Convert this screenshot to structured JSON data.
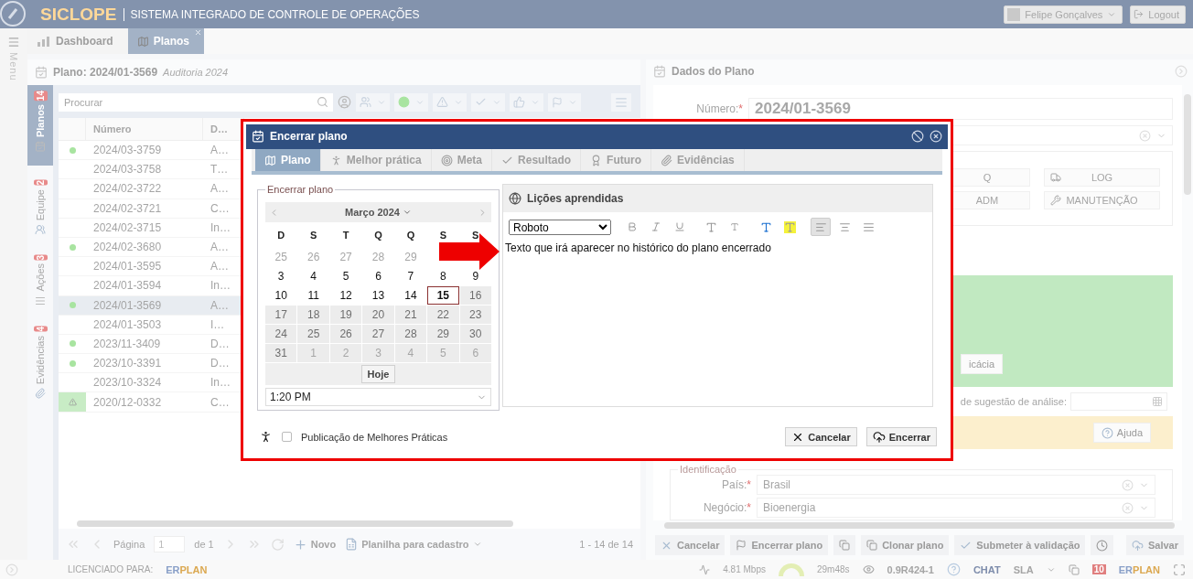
{
  "header": {
    "logo": "SICLOPE",
    "subtitle": "SISTEMA INTEGRADO DE CONTROLE DE OPERAÇÕES",
    "user": "Felipe Gonçalves",
    "logout": "Logout"
  },
  "side_menu": {
    "label": "Menu"
  },
  "tabs": [
    {
      "label": "Dashboard",
      "selected": false
    },
    {
      "label": "Planos",
      "selected": true
    }
  ],
  "plan_panel": {
    "title": "Plano: 2024/01-3569",
    "subtitle": "Auditoria 2024",
    "side_tabs": [
      {
        "label": "Planos",
        "count": "14",
        "selected": true
      },
      {
        "label": "Equipe",
        "count": "2",
        "selected": false
      },
      {
        "label": "Ações",
        "count": "3",
        "selected": false
      },
      {
        "label": "Evidências",
        "count": "4",
        "selected": false
      }
    ],
    "search": {
      "placeholder": "Procurar"
    },
    "table": {
      "columns": [
        "Número",
        "D…"
      ],
      "rows": [
        {
          "kind": "ok",
          "number": "2024/03-3759",
          "column_2": "A…",
          "selected": false
        },
        {
          "kind": "none",
          "number": "2024/03-3758",
          "column_2": "T…",
          "selected": false
        },
        {
          "kind": "none",
          "number": "2024/02-3722",
          "column_2": "A…",
          "selected": false
        },
        {
          "kind": "none",
          "number": "2024/02-3721",
          "column_2": "C…",
          "selected": false
        },
        {
          "kind": "none",
          "number": "2024/02-3715",
          "column_2": "In…",
          "selected": false
        },
        {
          "kind": "ok",
          "number": "2024/02-3680",
          "column_2": "A…",
          "selected": false
        },
        {
          "kind": "none",
          "number": "2024/01-3595",
          "column_2": "A…",
          "selected": false
        },
        {
          "kind": "none",
          "number": "2024/01-3594",
          "column_2": "In…",
          "selected": false
        },
        {
          "kind": "ok",
          "number": "2024/01-3569",
          "column_2": "A…",
          "selected": true
        },
        {
          "kind": "none",
          "number": "2024/01-3503",
          "column_2": "I…",
          "selected": false
        },
        {
          "kind": "ok",
          "number": "2023/11-3409",
          "column_2": "D…",
          "selected": false
        },
        {
          "kind": "ok",
          "number": "2023/10-3391",
          "column_2": "D…",
          "selected": false
        },
        {
          "kind": "none",
          "number": "2023/10-3324",
          "column_2": "In…",
          "selected": false
        },
        {
          "kind": "warning",
          "number": "2020/12-0332",
          "column_2": "C…",
          "selected": false
        }
      ]
    },
    "pager": {
      "page_label": "Página",
      "page": "1",
      "of": "de 1",
      "new": "Novo",
      "sheet": "Planilha para cadastro",
      "range": "1 - 14 de 14"
    }
  },
  "data_panel": {
    "title": "Dados do Plano",
    "number_label": "Número:",
    "number_mark": "*",
    "number": "2024/01-3569",
    "modules": [
      "Q",
      "LOG",
      "ADM",
      "MANUTENÇÃO"
    ],
    "efficacy_button": "icácia",
    "date_label": "de sugestão de análise:",
    "help": "Ajuda",
    "identification": {
      "legend": "Identificação",
      "fields": [
        {
          "label": "País:",
          "mark": "*",
          "value": "Brasil"
        },
        {
          "label": "Negócio:",
          "mark": "*",
          "value": "Bioenergia"
        }
      ]
    },
    "actions": [
      "Cancelar",
      "Encerrar plano",
      "Clonar plano",
      "Submeter à validação",
      "Salvar"
    ]
  },
  "status_bar": {
    "licensed": "LICENCIADO PARA:",
    "brand": [
      "ER",
      "PLAN"
    ],
    "brand_right": [
      "ER",
      "PLAN"
    ],
    "speed": "4.81 Mbps",
    "timer": "29m48s",
    "version": "0.9R424-1",
    "chat": "CHAT",
    "sla": "SLA",
    "count": "10"
  },
  "dialog": {
    "title": "Encerrar plano",
    "tabs": [
      {
        "label": "Plano",
        "selected": true
      },
      {
        "label": "Melhor prática",
        "selected": false
      },
      {
        "label": "Meta",
        "selected": false
      },
      {
        "label": "Resultado",
        "selected": false
      },
      {
        "label": "Futuro",
        "selected": false
      },
      {
        "label": "Evidências",
        "selected": false
      }
    ],
    "legend": "Encerrar plano",
    "month": "Março 2024",
    "weekdays": [
      "D",
      "S",
      "T",
      "Q",
      "Q",
      "S",
      "S"
    ],
    "weeks": [
      [
        {
          "d": "25",
          "muted": true,
          "disabled": false,
          "selected": false
        },
        {
          "d": "26",
          "muted": true,
          "disabled": false,
          "selected": false
        },
        {
          "d": "27",
          "muted": true,
          "disabled": false,
          "selected": false
        },
        {
          "d": "28",
          "muted": true,
          "disabled": false,
          "selected": false
        },
        {
          "d": "29",
          "muted": true,
          "disabled": false,
          "selected": false
        }
      ],
      [
        {
          "d": "3",
          "muted": false,
          "disabled": false,
          "selected": false
        },
        {
          "d": "4",
          "muted": false,
          "disabled": false,
          "selected": false
        },
        {
          "d": "5",
          "muted": false,
          "disabled": false,
          "selected": false
        },
        {
          "d": "6",
          "muted": false,
          "disabled": false,
          "selected": false
        },
        {
          "d": "7",
          "muted": false,
          "disabled": false,
          "selected": false
        },
        {
          "d": "8",
          "muted": false,
          "disabled": false,
          "selected": false
        },
        {
          "d": "9",
          "muted": false,
          "disabled": false,
          "selected": false
        }
      ],
      [
        {
          "d": "10",
          "muted": false,
          "disabled": false,
          "selected": false
        },
        {
          "d": "11",
          "muted": false,
          "disabled": false,
          "selected": false
        },
        {
          "d": "12",
          "muted": false,
          "disabled": false,
          "selected": false
        },
        {
          "d": "13",
          "muted": false,
          "disabled": false,
          "selected": false
        },
        {
          "d": "14",
          "muted": false,
          "disabled": false,
          "selected": false
        },
        {
          "d": "15",
          "muted": false,
          "disabled": false,
          "selected": true
        },
        {
          "d": "16",
          "muted": false,
          "disabled": true,
          "selected": false
        }
      ],
      [
        {
          "d": "17",
          "muted": false,
          "disabled": true,
          "selected": false
        },
        {
          "d": "18",
          "muted": false,
          "disabled": true,
          "selected": false
        },
        {
          "d": "19",
          "muted": false,
          "disabled": true,
          "selected": false
        },
        {
          "d": "20",
          "muted": false,
          "disabled": true,
          "selected": false
        },
        {
          "d": "21",
          "muted": false,
          "disabled": true,
          "selected": false
        },
        {
          "d": "22",
          "muted": false,
          "disabled": true,
          "selected": false
        },
        {
          "d": "23",
          "muted": false,
          "disabled": true,
          "selected": false
        }
      ],
      [
        {
          "d": "24",
          "muted": false,
          "disabled": true,
          "selected": false
        },
        {
          "d": "25",
          "muted": false,
          "disabled": true,
          "selected": false
        },
        {
          "d": "26",
          "muted": false,
          "disabled": true,
          "selected": false
        },
        {
          "d": "27",
          "muted": false,
          "disabled": true,
          "selected": false
        },
        {
          "d": "28",
          "muted": false,
          "disabled": true,
          "selected": false
        },
        {
          "d": "29",
          "muted": false,
          "disabled": true,
          "selected": false
        },
        {
          "d": "30",
          "muted": false,
          "disabled": true,
          "selected": false
        }
      ],
      [
        {
          "d": "31",
          "muted": false,
          "disabled": true,
          "selected": false
        },
        {
          "d": "1",
          "muted": true,
          "disabled": true,
          "selected": false
        },
        {
          "d": "2",
          "muted": true,
          "disabled": true,
          "selected": false
        },
        {
          "d": "3",
          "muted": true,
          "disabled": true,
          "selected": false
        },
        {
          "d": "4",
          "muted": true,
          "disabled": true,
          "selected": false
        },
        {
          "d": "5",
          "muted": true,
          "disabled": true,
          "selected": false
        },
        {
          "d": "6",
          "muted": true,
          "disabled": true,
          "selected": false
        }
      ]
    ],
    "today": "Hoje",
    "time": "1:20 PM",
    "editor": {
      "title": "Lições aprendidas",
      "font": "Roboto",
      "toolbar": [
        {
          "kind": "bold",
          "active": false
        },
        {
          "kind": "italic",
          "active": false
        },
        {
          "kind": "underline",
          "active": false
        },
        {
          "kind": "grow",
          "active": false
        },
        {
          "kind": "shrink",
          "active": false
        },
        {
          "kind": "color",
          "active": false
        },
        {
          "kind": "highlight",
          "active": false
        },
        {
          "kind": "align-left",
          "active": true
        },
        {
          "kind": "align-center",
          "active": false
        },
        {
          "kind": "justify",
          "active": false
        }
      ],
      "text": "Texto que irá aparecer no histórico do plano encerrado"
    },
    "publish": {
      "label": "Publicação de Melhores Práticas",
      "checked": false
    },
    "buttons": [
      "Cancelar",
      "Encerrar"
    ]
  }
}
